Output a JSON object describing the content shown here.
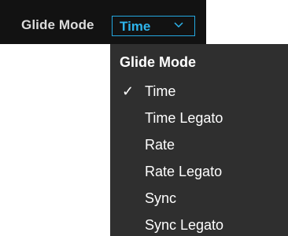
{
  "toolbar": {
    "label": "Glide Mode",
    "dropdown_value": "Time",
    "dropdown_icon": "chevron-down-icon",
    "accent_color": "#2eb4ec"
  },
  "menu": {
    "header": "Glide Mode",
    "selected_index": 0,
    "check_icon": "check-icon",
    "items": [
      {
        "label": "Time",
        "checked": "✓"
      },
      {
        "label": "Time Legato"
      },
      {
        "label": "Rate"
      },
      {
        "label": "Rate Legato"
      },
      {
        "label": "Sync"
      },
      {
        "label": "Sync Legato"
      }
    ]
  }
}
